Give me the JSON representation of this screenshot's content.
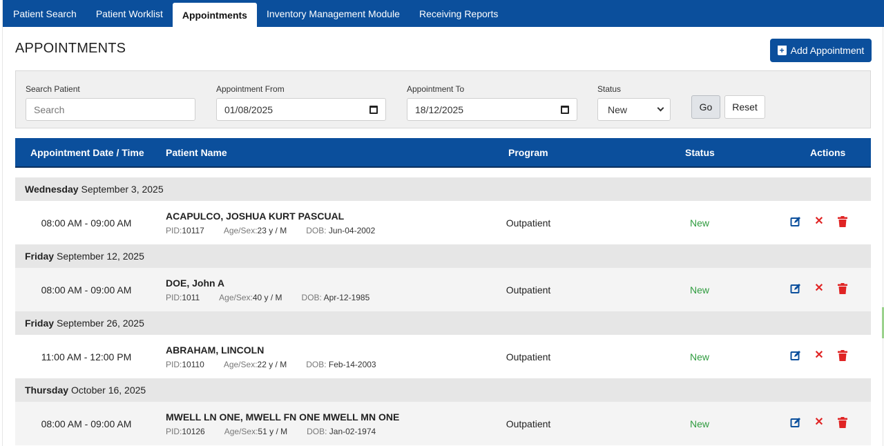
{
  "nav": {
    "tabs": [
      {
        "label": "Patient Search",
        "active": false
      },
      {
        "label": "Patient Worklist",
        "active": false
      },
      {
        "label": "Appointments",
        "active": true
      },
      {
        "label": "Inventory Management Module",
        "active": false
      },
      {
        "label": "Receiving Reports",
        "active": false
      }
    ]
  },
  "page": {
    "title": "APPOINTMENTS",
    "add_button": "Add Appointment"
  },
  "filters": {
    "search_label": "Search Patient",
    "search_placeholder": "Search",
    "from_label": "Appointment From",
    "from_value": "01/08/2025",
    "to_label": "Appointment To",
    "to_value": "18/12/2025",
    "status_label": "Status",
    "status_value": "New",
    "go_label": "Go",
    "reset_label": "Reset"
  },
  "table": {
    "headers": {
      "datetime": "Appointment Date / Time",
      "patient": "Patient Name",
      "program": "Program",
      "status": "Status",
      "actions": "Actions"
    },
    "groups": [
      {
        "weekday": "Wednesday",
        "date": "September 3, 2025",
        "appointments": [
          {
            "time": "08:00 AM - 09:00 AM",
            "name": "ACAPULCO, JOSHUA KURT PASCUAL",
            "pid_label": "PID:",
            "pid": "10117",
            "agesex_label": "Age/Sex:",
            "agesex": "23 y / M",
            "dob_label": "DOB: ",
            "dob": "Jun-04-2002",
            "program": "Outpatient",
            "status": "New"
          }
        ]
      },
      {
        "weekday": "Friday",
        "date": "September 12, 2025",
        "appointments": [
          {
            "time": "08:00 AM - 09:00 AM",
            "name": "DOE, John A",
            "pid_label": "PID:",
            "pid": "1011",
            "agesex_label": "Age/Sex:",
            "agesex": "40 y / M",
            "dob_label": "DOB: ",
            "dob": "Apr-12-1985",
            "program": "Outpatient",
            "status": "New"
          }
        ]
      },
      {
        "weekday": "Friday",
        "date": "September 26, 2025",
        "appointments": [
          {
            "time": "11:00 AM - 12:00 PM",
            "name": "ABRAHAM, LINCOLN",
            "pid_label": "PID:",
            "pid": "10110",
            "agesex_label": "Age/Sex:",
            "agesex": "22 y / M",
            "dob_label": "DOB: ",
            "dob": "Feb-14-2003",
            "program": "Outpatient",
            "status": "New"
          }
        ]
      },
      {
        "weekday": "Thursday",
        "date": "October 16, 2025",
        "appointments": [
          {
            "time": "08:00 AM - 09:00 AM",
            "name": "MWELL LN ONE, MWELL FN ONE MWELL MN ONE",
            "pid_label": "PID:",
            "pid": "10126",
            "agesex_label": "Age/Sex:",
            "agesex": "51 y / M",
            "dob_label": "DOB: ",
            "dob": "Jan-02-1974",
            "program": "Outpatient",
            "status": "New"
          }
        ]
      }
    ]
  },
  "colors": {
    "brand": "#0b4f9c",
    "status_new": "#2e9b3e",
    "delete": "#e02424",
    "edit": "#0b4f9c"
  },
  "icons": {
    "edit": "edit-icon",
    "cancel": "close-icon",
    "delete": "trash-icon",
    "calendar": "calendar-icon",
    "add": "calendar-plus-icon"
  }
}
